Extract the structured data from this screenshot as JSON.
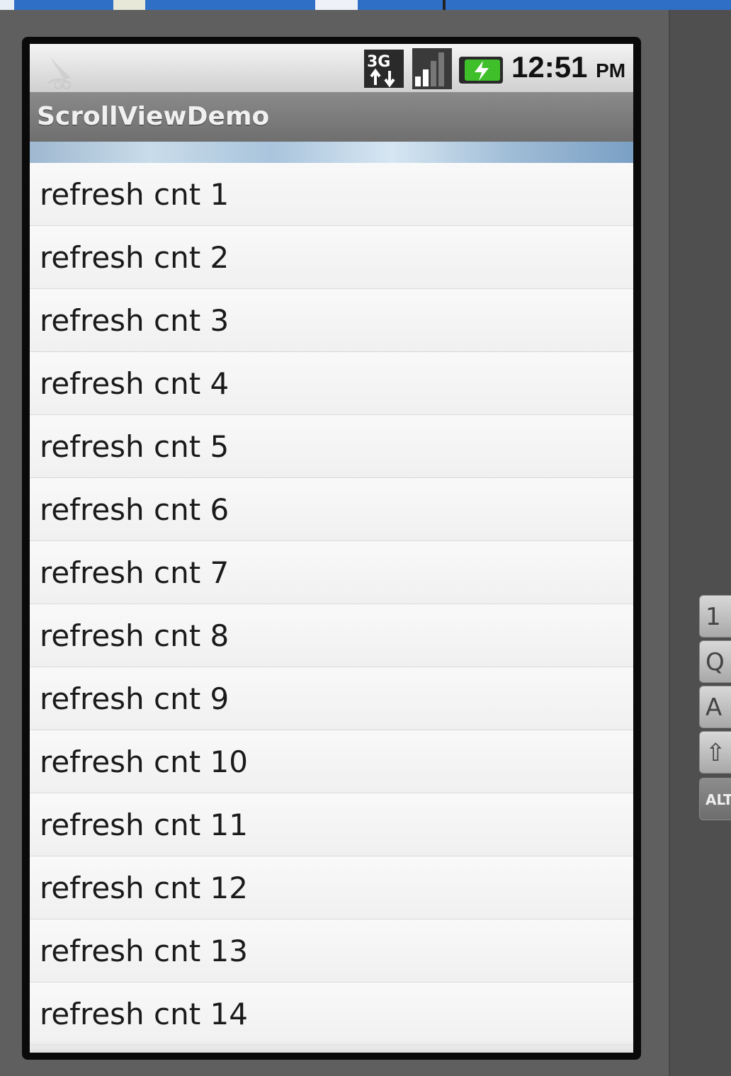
{
  "status_bar": {
    "time": "12:51",
    "ampm": "PM",
    "network_icon": "3g-icon",
    "signal_icon": "signal-icon",
    "battery_icon": "battery-charging-icon",
    "notification_icon": "notification-icon"
  },
  "app": {
    "title": "ScrollViewDemo"
  },
  "list": {
    "items": [
      "refresh cnt 1",
      "refresh cnt 2",
      "refresh cnt 3",
      "refresh cnt 4",
      "refresh cnt 5",
      "refresh cnt 6",
      "refresh cnt 7",
      "refresh cnt 8",
      "refresh cnt 9",
      "refresh cnt 10",
      "refresh cnt 11",
      "refresh cnt 12",
      "refresh cnt 13",
      "refresh cnt 14"
    ]
  },
  "keyboard_side": {
    "keys": [
      "1",
      "Q",
      "A",
      "⇧",
      "ALT"
    ]
  },
  "colors": {
    "titlebar": "#7a7a7a",
    "list_bg": "#f3f3f3",
    "text": "#1a1a1a"
  }
}
